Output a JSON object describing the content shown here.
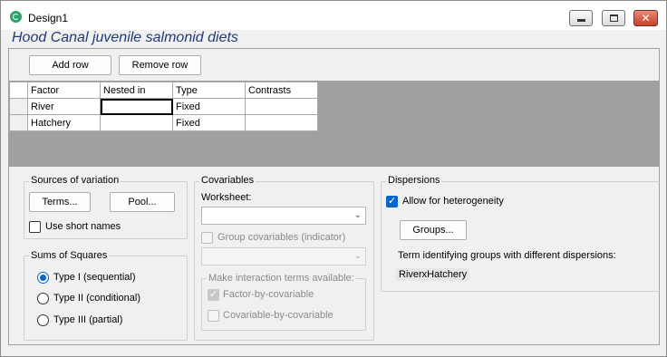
{
  "window": {
    "title": "Design1",
    "minimize_glyph": "",
    "maximize_glyph": "",
    "close_glyph": "✕"
  },
  "heading": "Hood Canal juvenile salmonid diets",
  "toolbar": {
    "add_row_label": "Add row",
    "remove_row_label": "Remove row"
  },
  "grid": {
    "columns": [
      "Factor",
      "Nested in",
      "Type",
      "Contrasts"
    ],
    "rows": [
      [
        "River",
        "",
        "Fixed",
        ""
      ],
      [
        "Hatchery",
        "",
        "Fixed",
        ""
      ]
    ]
  },
  "sources": {
    "label": "Sources of variation",
    "terms_button": "Terms...",
    "pool_button": "Pool...",
    "short_names_label": "Use short names",
    "short_names_checked": false
  },
  "sums": {
    "label": "Sums of Squares",
    "options": [
      "Type I (sequential)",
      "Type II (conditional)",
      "Type III (partial)"
    ],
    "selected": "Type I (sequential)"
  },
  "covariables": {
    "label": "Covariables",
    "worksheet_label": "Worksheet:",
    "worksheet_value": "",
    "group_label": "Group covariables (indicator)",
    "group_value": "",
    "interaction_label": "Make interaction terms available:",
    "factor_cov_label": "Factor-by-covariable",
    "factor_cov_checked": true,
    "cov_cov_label": "Covariable-by-covariable",
    "cov_cov_checked": false,
    "dropdown_glyph": "⌄"
  },
  "dispersions": {
    "label": "Dispersions",
    "allow_label": "Allow for heterogeneity",
    "allow_checked": true,
    "groups_button": "Groups...",
    "term_label": "Term identifying groups with different dispersions:",
    "term_value": "RiverxHatchery"
  },
  "colors": {
    "heading": "#1f3a78",
    "accent": "#0a64c8",
    "grid_background": "#a0a0a0"
  }
}
